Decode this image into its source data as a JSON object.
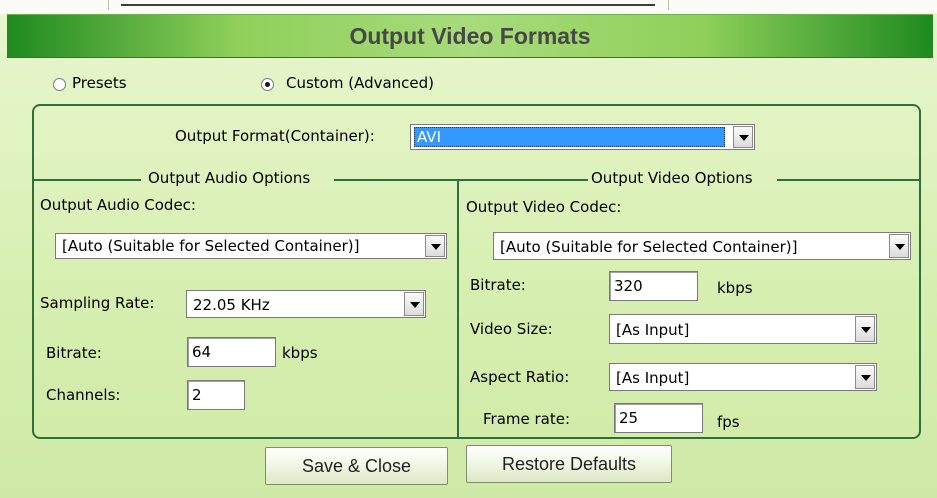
{
  "dialog": {
    "title": "Output Video Formats",
    "mode_presets": "Presets",
    "mode_custom": "Custom (Advanced)",
    "selected_mode": "Custom (Advanced)"
  },
  "container": {
    "label": "Output Format(Container):",
    "value": "AVI"
  },
  "audio": {
    "group_title": "Output Audio Options",
    "codec_label": "Output Audio Codec:",
    "codec_value": "[Auto (Suitable for Selected Container)]",
    "sampling_label": "Sampling Rate:",
    "sampling_value": "22.05 KHz",
    "bitrate_label": "Bitrate:",
    "bitrate_value": "64",
    "bitrate_unit": "kbps",
    "channels_label": "Channels:",
    "channels_value": "2"
  },
  "video": {
    "group_title": "Output Video Options",
    "codec_label": "Output Video Codec:",
    "codec_value": "[Auto (Suitable for Selected Container)]",
    "bitrate_label": "Bitrate:",
    "bitrate_value": "320",
    "bitrate_unit": "kbps",
    "size_label": "Video Size:",
    "size_value": "[As Input]",
    "aspect_label": "Aspect Ratio:",
    "aspect_value": "[As Input]",
    "framerate_label": "Frame rate:",
    "framerate_value": "25",
    "framerate_unit": "fps"
  },
  "buttons": {
    "save_close": "Save & Close",
    "restore_defaults": "Restore Defaults"
  },
  "colors": {
    "background": "#d6efb0",
    "frame_line": "#2f6f3a",
    "selection": "#3399ff",
    "title_text": "#474747"
  }
}
